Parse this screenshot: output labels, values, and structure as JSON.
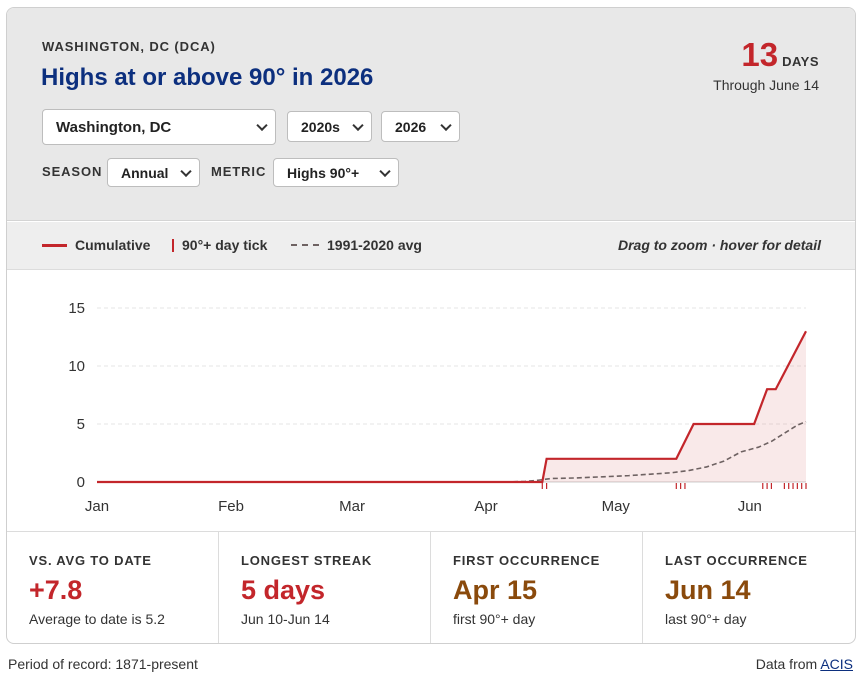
{
  "header": {
    "station": "WASHINGTON, DC (DCA)",
    "title": "Highs at or above 90° in 2026",
    "count": "13",
    "count_unit": "DAYS",
    "through": "Through June 14"
  },
  "controls": {
    "location": "Washington, DC",
    "decade": "2020s",
    "year": "2026",
    "season_label": "SEASON",
    "season": "Annual",
    "metric_label": "METRIC",
    "metric": "Highs 90°+"
  },
  "legend": {
    "cumulative": "Cumulative",
    "tick": "90°+ day tick",
    "avg": "1991-2020 avg",
    "hint": "Drag to zoom · hover for detail"
  },
  "colors": {
    "accent_red": "#c3262b",
    "title_blue": "#0c2f7e",
    "avg_gray": "#6e6262",
    "brown": "#8a4a0c"
  },
  "chart_data": {
    "type": "line",
    "x_axis": "day of year 2026",
    "month_ticks": [
      {
        "label": "Jan",
        "day": 1
      },
      {
        "label": "Feb",
        "day": 32
      },
      {
        "label": "Mar",
        "day": 60
      },
      {
        "label": "Apr",
        "day": 91
      },
      {
        "label": "May",
        "day": 121
      },
      {
        "label": "Jun",
        "day": 152
      }
    ],
    "y_ticks": [
      0,
      5,
      10,
      15
    ],
    "ylim": [
      0,
      15
    ],
    "xlim": [
      1,
      165
    ],
    "grid": true,
    "series": [
      {
        "name": "Cumulative",
        "color": "#c3262b",
        "points": [
          [
            1,
            0
          ],
          [
            104,
            0
          ],
          [
            105,
            2
          ],
          [
            135,
            2
          ],
          [
            139,
            5
          ],
          [
            153,
            5
          ],
          [
            156,
            8
          ],
          [
            158,
            8
          ],
          [
            165,
            13
          ]
        ]
      },
      {
        "name": "1991-2020 avg",
        "color": "#6e6262",
        "dashed": true,
        "points": [
          [
            1,
            0
          ],
          [
            95,
            0
          ],
          [
            100,
            0.05
          ],
          [
            103,
            0.15
          ],
          [
            106,
            0.3
          ],
          [
            112,
            0.35
          ],
          [
            118,
            0.45
          ],
          [
            124,
            0.55
          ],
          [
            130,
            0.7
          ],
          [
            134,
            0.8
          ],
          [
            138,
            1.0
          ],
          [
            142,
            1.3
          ],
          [
            146,
            1.8
          ],
          [
            150,
            2.6
          ],
          [
            154,
            3.0
          ],
          [
            157,
            3.5
          ],
          [
            160,
            4.2
          ],
          [
            163,
            4.9
          ],
          [
            165,
            5.2
          ]
        ]
      }
    ],
    "hot_days": [
      104,
      105,
      135,
      136,
      137,
      155,
      156,
      157,
      160,
      161,
      162,
      163,
      164,
      165
    ]
  },
  "stats": [
    {
      "label": "VS. AVG TO DATE",
      "value": "+7.8",
      "sub": "Average to date is 5.2",
      "tone": "red"
    },
    {
      "label": "LONGEST STREAK",
      "value": "5 days",
      "sub": "Jun 10-Jun 14",
      "tone": "red"
    },
    {
      "label": "FIRST OCCURRENCE",
      "value": "Apr 15",
      "sub": "first 90°+ day",
      "tone": "brown"
    },
    {
      "label": "LAST OCCURRENCE",
      "value": "Jun 14",
      "sub": "last 90°+ day",
      "tone": "brown"
    }
  ],
  "footer": {
    "period": "Period of record: 1871-present",
    "source_prefix": "Data from",
    "source_link": "ACIS"
  }
}
